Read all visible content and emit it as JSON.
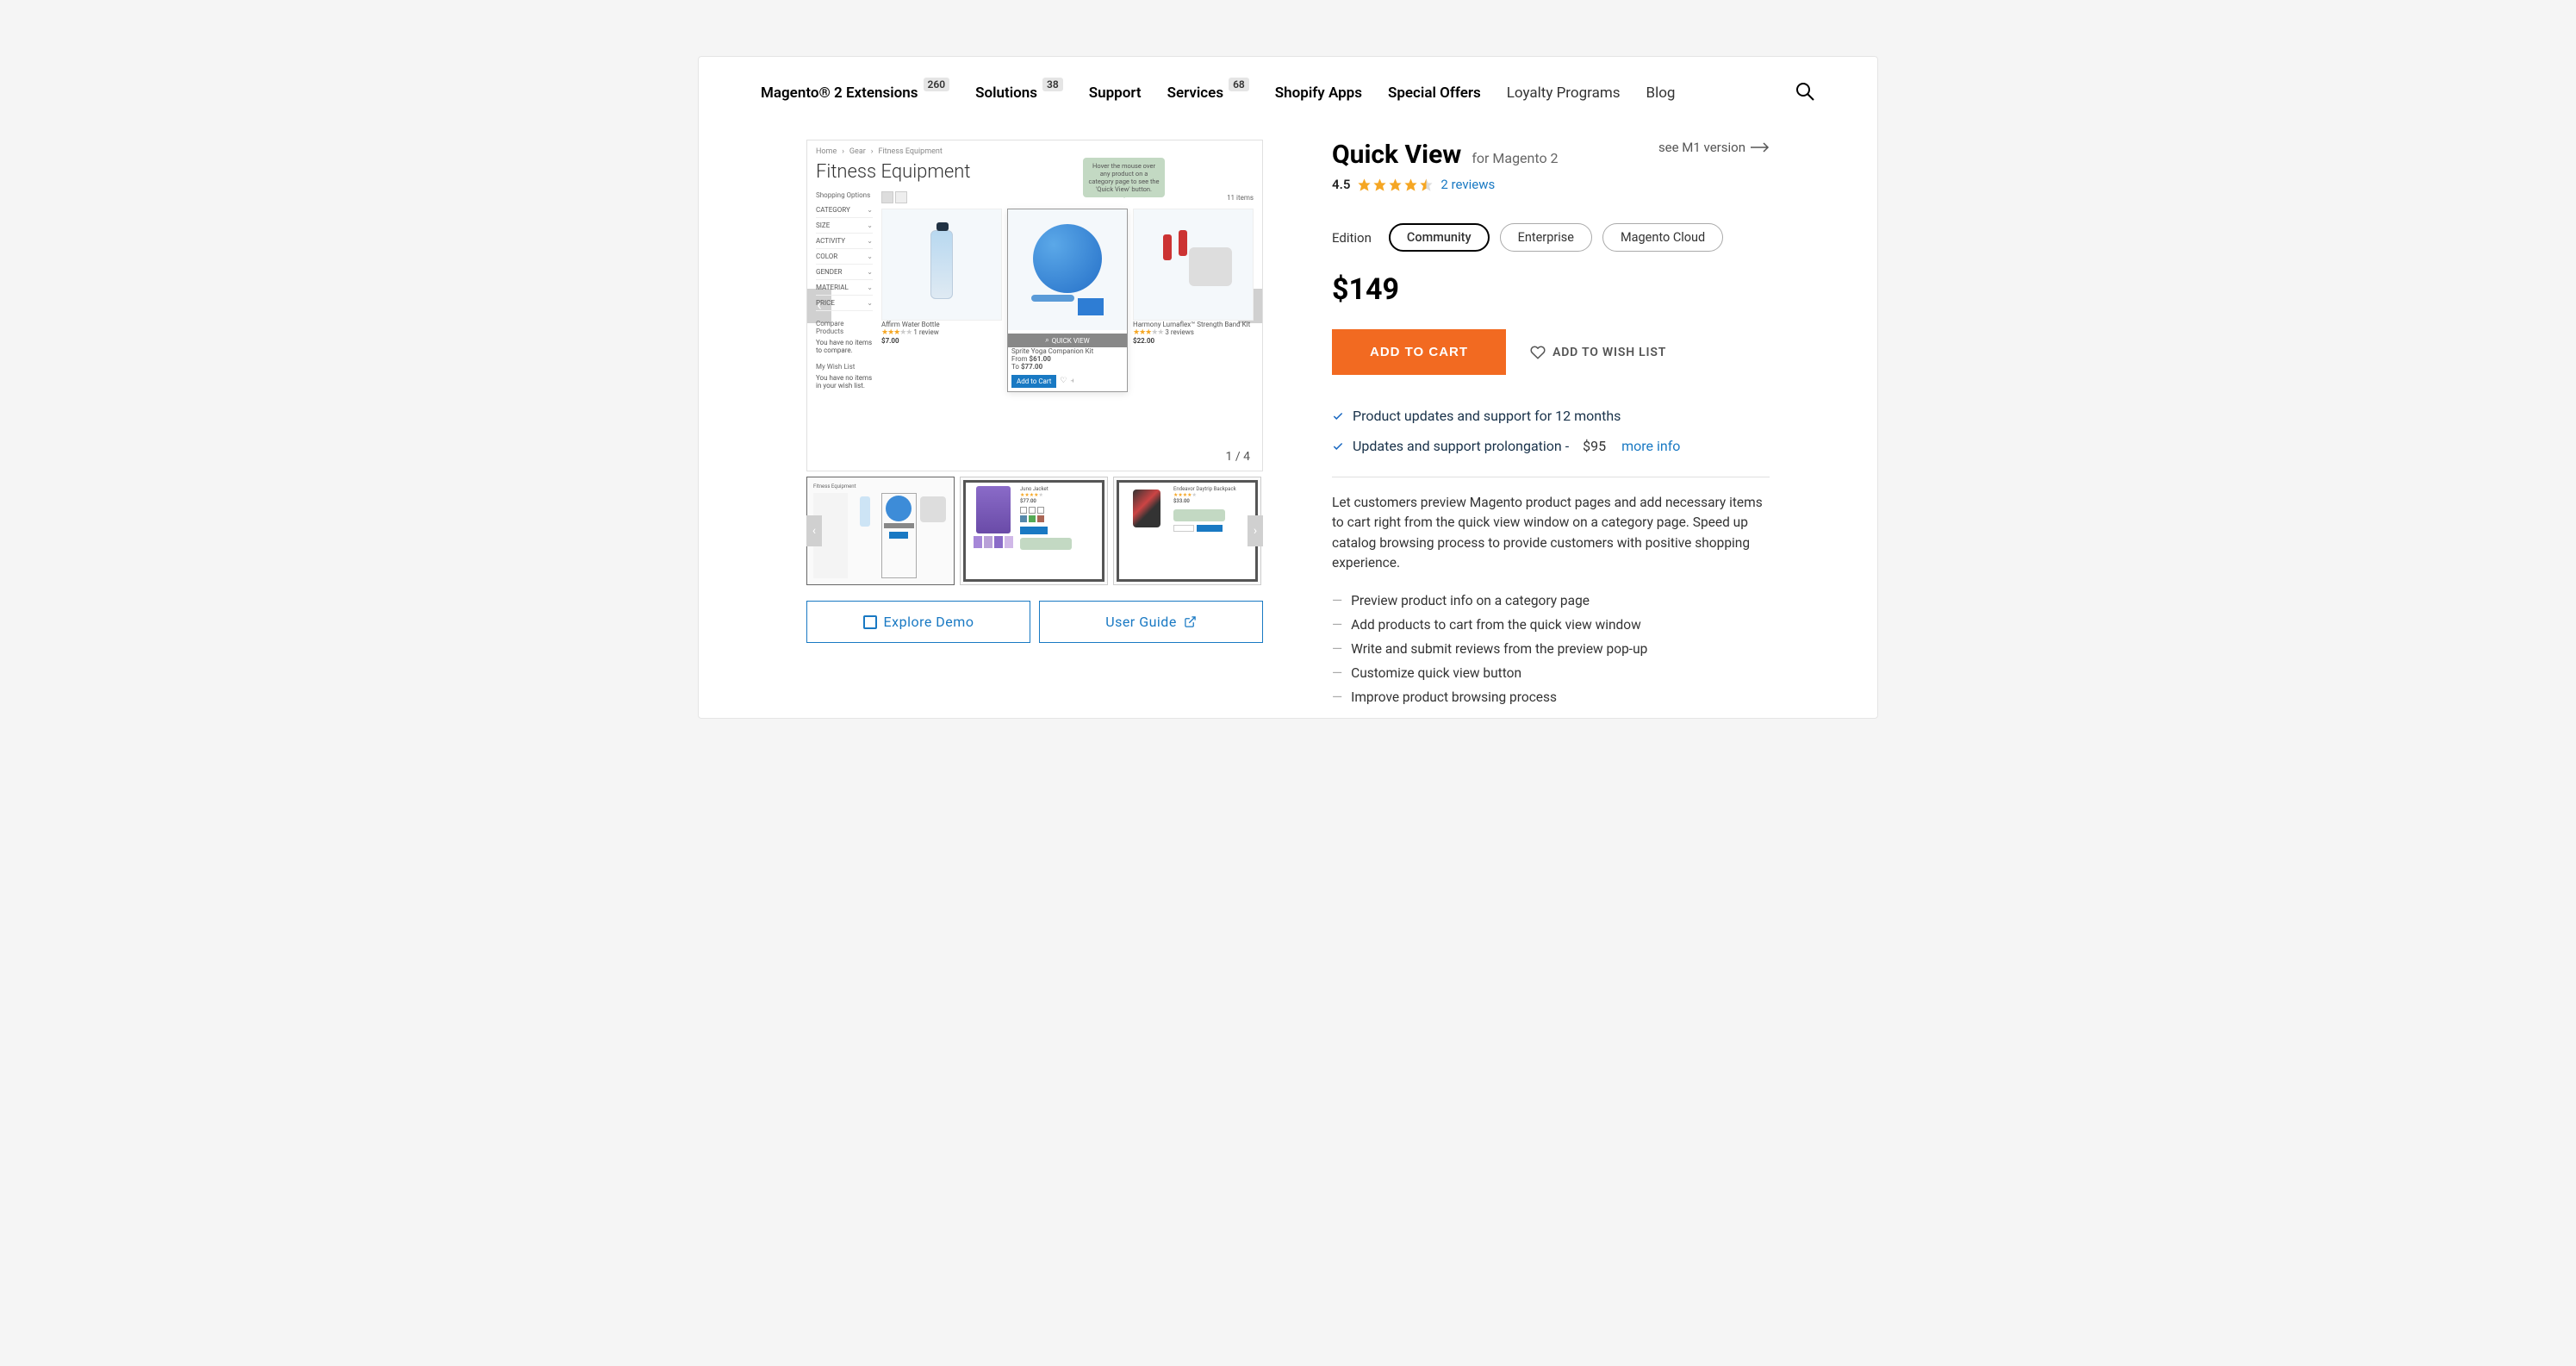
{
  "nav": {
    "items": [
      {
        "label": "Magento® 2 Extensions",
        "badge": "260"
      },
      {
        "label": "Solutions",
        "badge": "38"
      },
      {
        "label": "Support",
        "badge": null
      },
      {
        "label": "Services",
        "badge": "68"
      },
      {
        "label": "Shopify Apps",
        "badge": null
      },
      {
        "label": "Special Offers",
        "badge": null
      },
      {
        "label": "Loyalty Programs",
        "badge": null,
        "light": true
      },
      {
        "label": "Blog",
        "badge": null,
        "light": true
      }
    ]
  },
  "gallery": {
    "counter": "1 / 4",
    "crumbs": [
      "Home",
      "Gear",
      "Fitness Equipment"
    ],
    "title": "Fitness Equipment",
    "shopping_options": "Shopping Options",
    "item_count": "11 items",
    "filters": [
      "CATEGORY",
      "SIZE",
      "ACTIVITY",
      "COLOR",
      "GENDER",
      "MATERIAL",
      "PRICE"
    ],
    "compare_h": "Compare Products",
    "compare_text": "You have no items to compare.",
    "wish_h": "My Wish List",
    "wish_text": "You have no items in your wish list.",
    "tooltip": "Hover the mouse over any product on a category page to see the 'Quick View' button.",
    "products": [
      {
        "name": "Affirm Water Bottle",
        "reviews": "1 review",
        "price": "$7.00"
      },
      {
        "name": "Sprite Yoga Companion Kit",
        "from_label": "From",
        "from": "$61.00",
        "to_label": "To",
        "to": "$77.00",
        "qv": "QUICK VIEW",
        "add": "Add to Cart"
      },
      {
        "name": "Harmony Lumaflex™ Strength Band Kit",
        "reviews": "3 reviews",
        "price": "$22.00"
      }
    ],
    "thumb2": {
      "title": "Juno Jacket",
      "price": "$77.00"
    },
    "thumb3": {
      "title": "Endeavor Daytrip Backpack",
      "price": "$33.00"
    }
  },
  "buttons": {
    "explore": "Explore Demo",
    "guide": "User Guide"
  },
  "product": {
    "title": "Quick View",
    "subtitle": "for Magento 2",
    "m1": "see M1 version",
    "rating": "4.5",
    "reviews": "2 reviews",
    "edition_label": "Edition",
    "editions": [
      "Community",
      "Enterprise",
      "Magento Cloud"
    ],
    "price": "$149",
    "add_to_cart": "ADD TO CART",
    "add_to_wish": "ADD TO WISH LIST",
    "feat1": "Product updates and support for 12 months",
    "feat2": "Updates and support prolongation -",
    "feat2_price": "$95",
    "feat2_more": "more info",
    "description": "Let customers preview Magento product pages and add necessary items to cart right from the quick view window on a category page. Speed up catalog browsing process to provide customers with positive shopping experience.",
    "bullets": [
      "Preview product info on a category page",
      "Add products to cart from the quick view window",
      "Write and submit reviews from the preview pop-up",
      "Customize quick view button",
      "Improve product browsing process"
    ]
  }
}
